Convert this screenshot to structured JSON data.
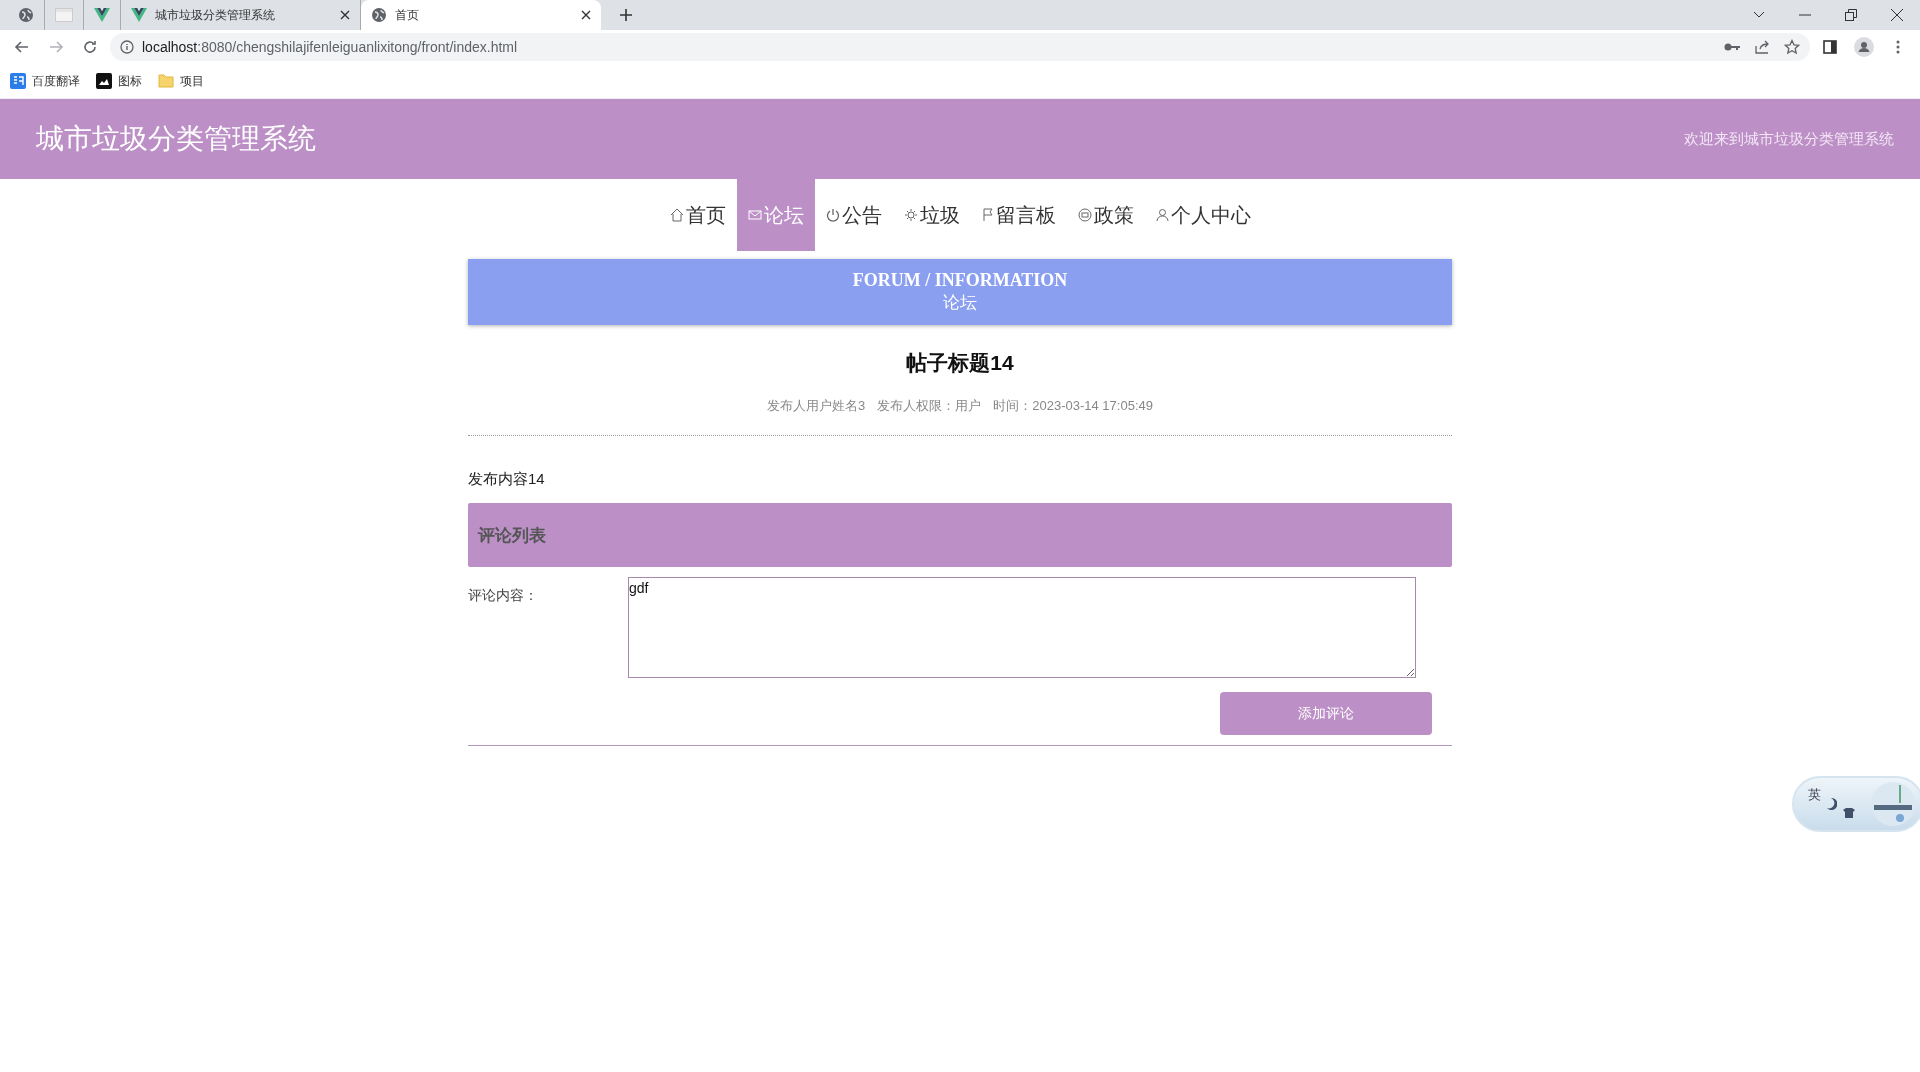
{
  "browser": {
    "tabs": [
      {
        "selected": false,
        "kind": "globe"
      },
      {
        "selected": false,
        "kind": "blank"
      },
      {
        "selected": false,
        "kind": "vue"
      },
      {
        "title": "城市垃圾分类管理系统",
        "selected": false,
        "kind": "vue"
      },
      {
        "title": "首页",
        "selected": true,
        "kind": "globe"
      }
    ],
    "url_host": "localhost",
    "url_rest": ":8080/chengshilajifenleiguanlixitong/front/index.html",
    "bookmarks": [
      {
        "label": "百度翻译",
        "kind": "translate"
      },
      {
        "label": "图标",
        "kind": "image"
      },
      {
        "label": "项目",
        "kind": "folder"
      }
    ]
  },
  "header": {
    "title": "城市垃圾分类管理系统",
    "welcome": "欢迎来到城市垃圾分类管理系统"
  },
  "nav": [
    {
      "label": "首页",
      "selected": false
    },
    {
      "label": "论坛",
      "selected": true
    },
    {
      "label": "公告",
      "selected": false
    },
    {
      "label": "垃圾",
      "selected": false
    },
    {
      "label": "留言板",
      "selected": false
    },
    {
      "label": "政策",
      "selected": false
    },
    {
      "label": "个人中心",
      "selected": false
    }
  ],
  "banner": {
    "title": "FORUM / INFORMATION",
    "subtitle": "论坛"
  },
  "post": {
    "title": "帖子标题14",
    "meta": [
      "发布人用户姓名3",
      "发布人权限：用户",
      "时间：2023-03-14 17:05:49"
    ],
    "content": "发布内容14"
  },
  "comments": {
    "heading": "评论列表",
    "label": "评论内容：",
    "value": "gdf",
    "button": "添加评论"
  },
  "ime": {
    "mode": "英"
  }
}
